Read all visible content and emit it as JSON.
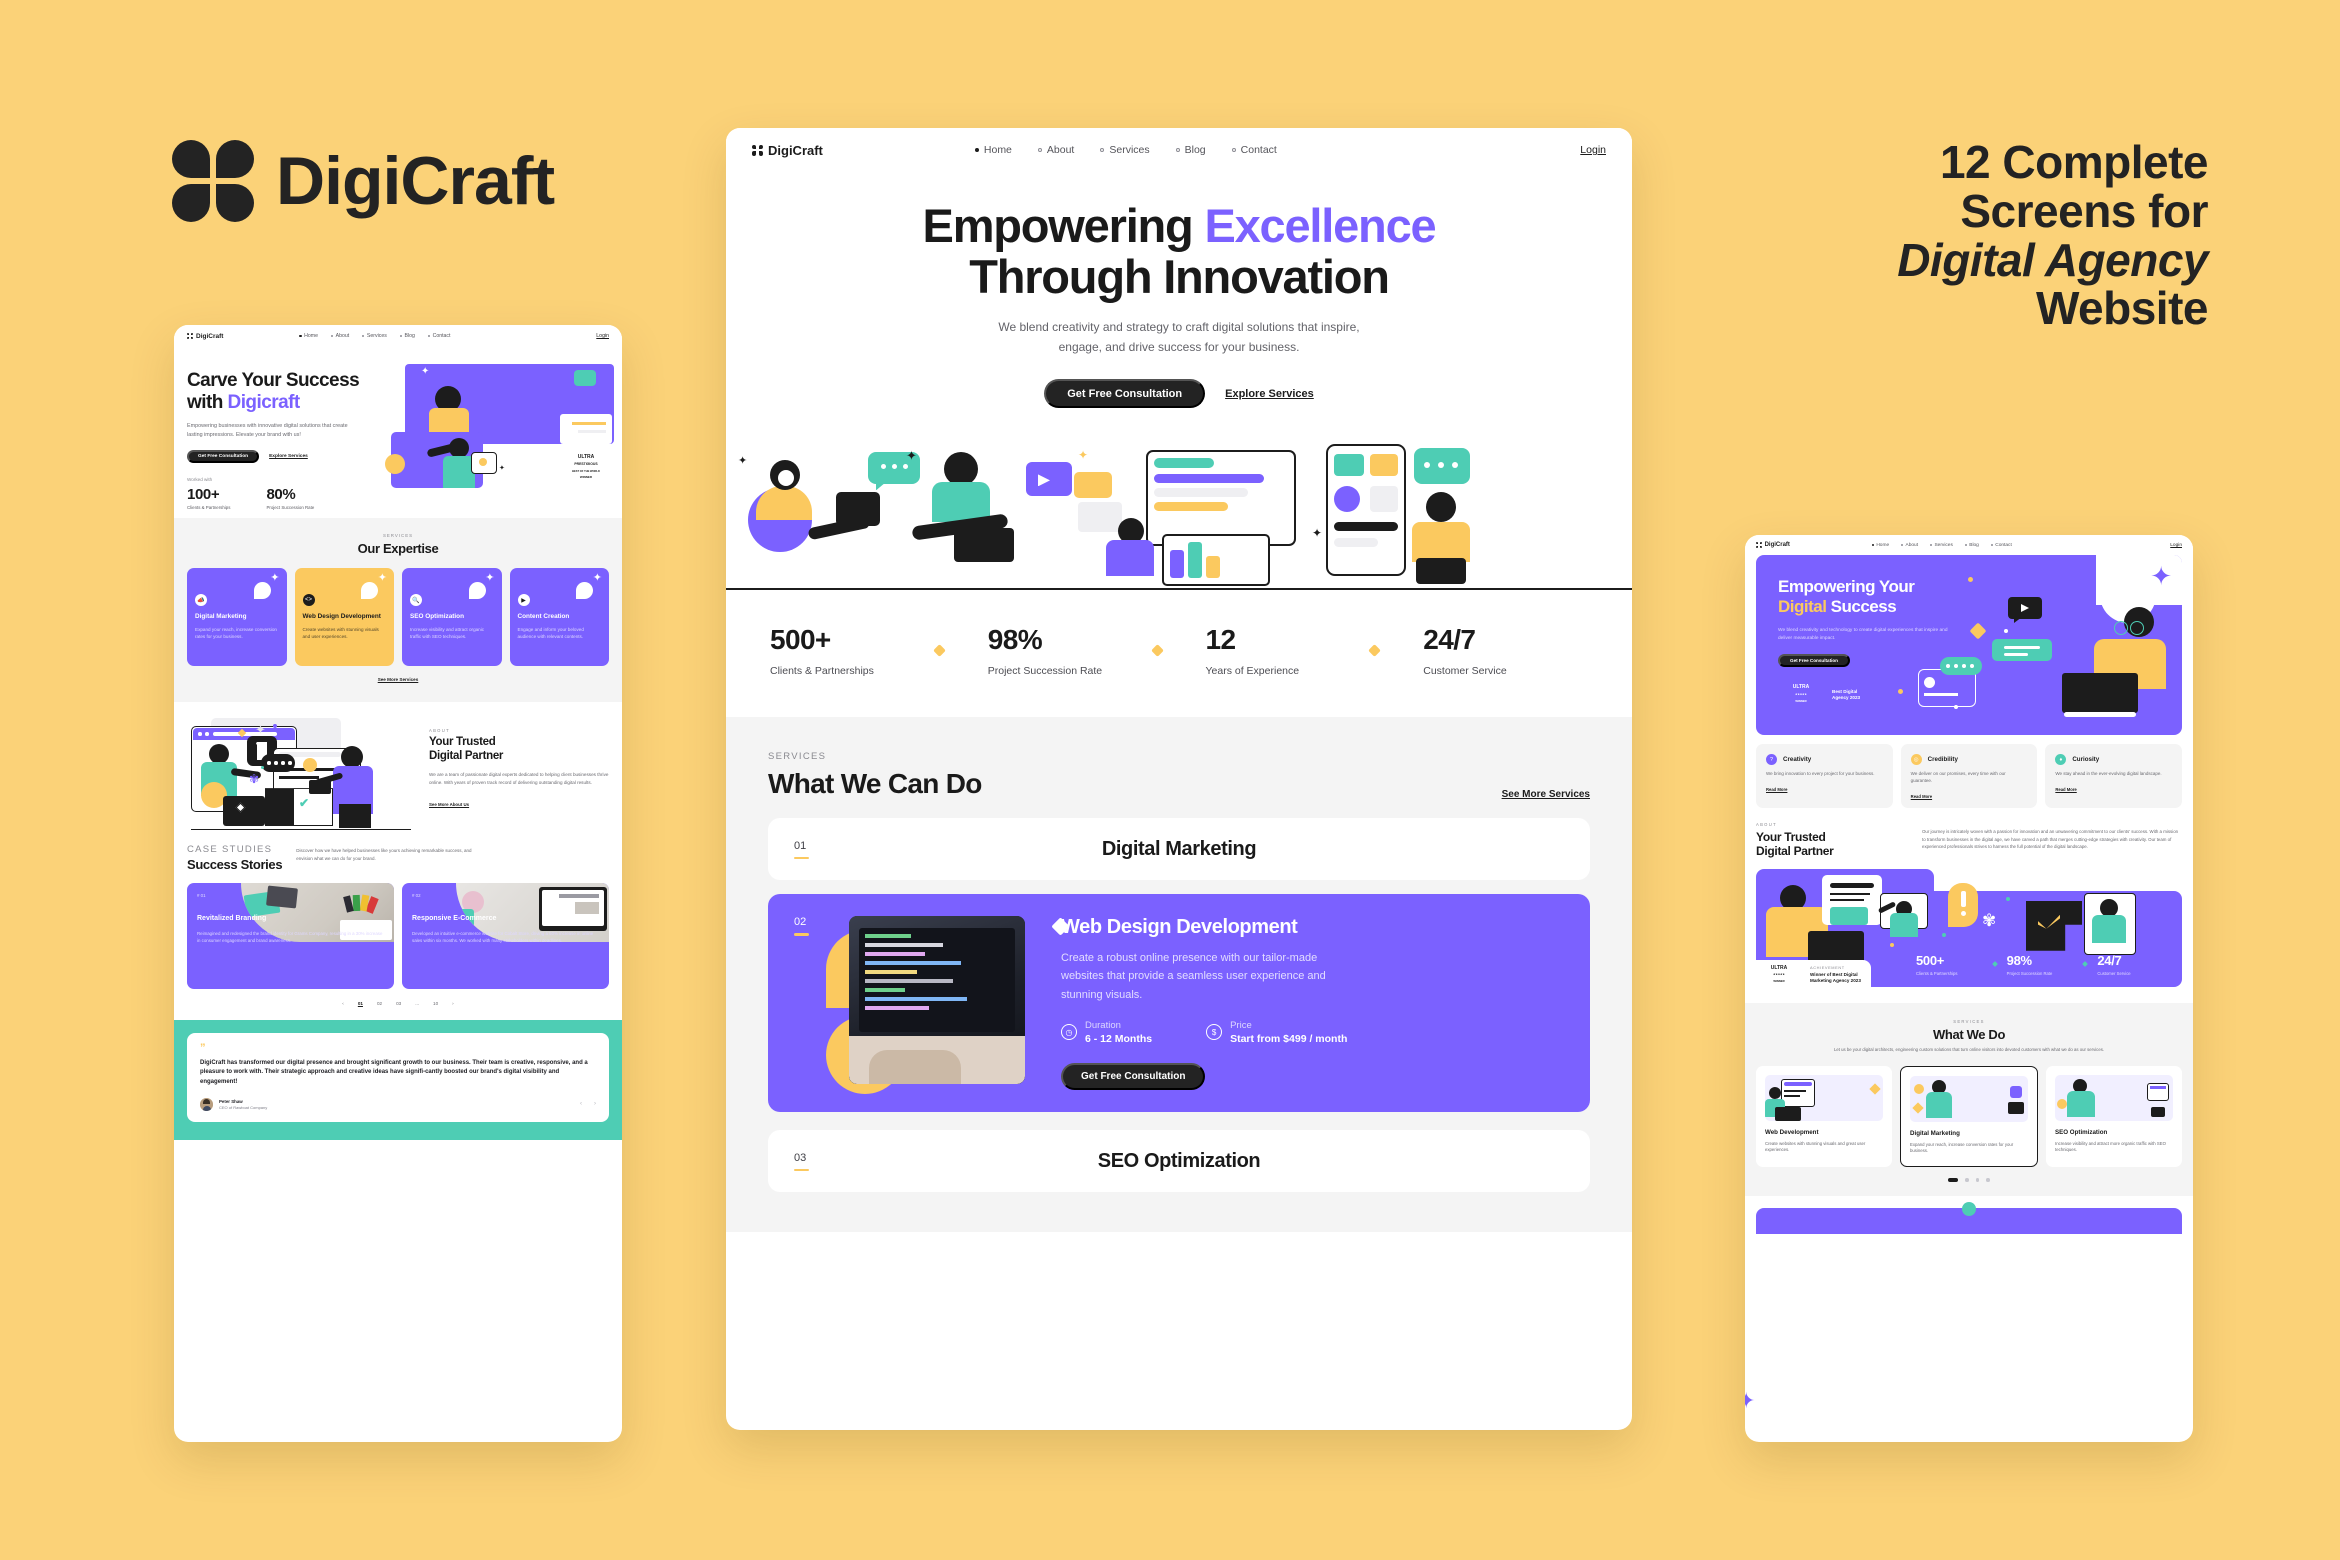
{
  "brand": {
    "name": "DigiCraft"
  },
  "promo": {
    "line1": "12 Complete",
    "line2": "Screens for",
    "line3": "Digital  Agency",
    "line4": "Website"
  },
  "nav": {
    "logo": "DigiCraft",
    "items": [
      {
        "label": "Home",
        "active": true
      },
      {
        "label": "About",
        "active": false
      },
      {
        "label": "Services",
        "active": false
      },
      {
        "label": "Blog",
        "active": false
      },
      {
        "label": "Contact",
        "active": false
      }
    ],
    "login": "Login"
  },
  "center": {
    "hero": {
      "title_plain": "Empowering ",
      "title_accent": "Excellence",
      "title_line2": "Through Innovation",
      "subtitle_line1": "We blend creativity and strategy to craft digital solutions that inspire,",
      "subtitle_line2": "engage, and drive success for your business.",
      "primary_cta": "Get Free Consultation",
      "secondary_cta": "Explore Services"
    },
    "stats": [
      {
        "value": "500+",
        "label": "Clients & Partnerships"
      },
      {
        "value": "98%",
        "label": "Project Succession Rate"
      },
      {
        "value": "12",
        "label": "Years of Experience"
      },
      {
        "value": "24/7",
        "label": "Customer Service"
      }
    ],
    "services": {
      "eyebrow": "SERVICES",
      "title": "What We Can Do",
      "see_more": "See More Services",
      "rows": [
        {
          "num": "01",
          "title": "Digital Marketing"
        },
        {
          "num": "03",
          "title": "SEO Optimization"
        }
      ],
      "expanded": {
        "num": "02",
        "title": "Web Design Development",
        "desc": "Create a robust online presence with our tailor-made websites that provide a seamless user experience and stunning visuals.",
        "duration_label": "Duration",
        "duration_value": "6 - 12 Months",
        "price_label": "Price",
        "price_value": "Start from $499 / month",
        "cta": "Get Free Consultation"
      }
    }
  },
  "left": {
    "hero": {
      "title_line1": "Carve Your Success",
      "title_line2_plain": "with ",
      "title_line2_accent": "Digicraft",
      "subtitle": "Empowering businesses with innovative digital solutions that create lasting impressions. Elevate your brand with us!",
      "primary_cta": "Get Free Consultation",
      "secondary_cta": "Explore Services",
      "worked_with": "Worked with",
      "stats": [
        {
          "value": "100+",
          "label": "Clients & Partnerships"
        },
        {
          "value": "80%",
          "label": "Project Succession Rate"
        }
      ],
      "award_line1": "ULTRA",
      "award_line2": "PRESTIGIOUS",
      "award_line3": "BEST OF THE WORLD",
      "award_line4": "WINNER"
    },
    "expertise": {
      "eyebrow": "SERVICES",
      "title": "Our Expertise",
      "see_more": "See More Services",
      "cards": [
        {
          "icon": "megaphone-icon",
          "title": "Digital Marketing",
          "desc": "Expand your reach, increase conversion rates for your business.",
          "theme": "p"
        },
        {
          "icon": "code-icon",
          "title": "Web Design Development",
          "desc": "Create websites with stunning visuals and user experiences.",
          "theme": "y"
        },
        {
          "icon": "search-icon",
          "title": "SEO Optimization",
          "desc": "Increase visibility and attract organic traffic with SEO techniques.",
          "theme": "p"
        },
        {
          "icon": "video-icon",
          "title": "Content Creation",
          "desc": "Engage and inform your beloved audience with relevant contents.",
          "theme": "p"
        }
      ]
    },
    "about": {
      "eyebrow": "ABOUT",
      "title_line1": "Your Trusted",
      "title_line2": "Digital Partner",
      "desc": "We are a team of passionate digital experts dedicated to helping client businesses thrive online. With years of proven track record of delivering outstanding digital results.",
      "link": "See More About Us"
    },
    "cases": {
      "eyebrow": "CASE STUDIES",
      "title": "Success Stories",
      "desc": "Discover how we have helped businesses like yours achieving remarkable success, and envision what we can do for your brand.",
      "cards": [
        {
          "idx": "# 01",
          "title": "Revitalized Branding",
          "desc": "Reimagined and redesigned the brand identity for Grams Company, resulting in a 30% increase in consumer engagement and brand awareness."
        },
        {
          "idx": "# 02",
          "title": "Responsive E-Commerce",
          "desc": "Developed an intuitive e-commerce website for Cobalt Store, driving a 50% increase in online sales within six months. We worked with many stakeholders within deadlines."
        }
      ],
      "pager": [
        "01",
        "02",
        "03",
        "...",
        "10"
      ],
      "pager_current": "01",
      "prev": "‹",
      "next": "›"
    },
    "testimonial": {
      "quote_mark": "”",
      "text": "DigiCraft has transformed our digital presence and brought significant growth to our business. Their team is creative, responsive, and a pleasure to work with. Their strategic approach and creative ideas have signifi-cantly boosted our brand's digital visibility and engagement!",
      "author": "Peter Shaw",
      "role": "CEO of Rawboat Company",
      "prev": "‹",
      "next": "›"
    }
  },
  "right": {
    "hero": {
      "title_line1": "Empowering Your",
      "title_line2_accent": "Digital",
      "title_line2_plain": " Success",
      "subtitle": "We blend creativity and technology to create digital experiences that inspire and deliver measurable impact.",
      "cta": "Get Free Consultation",
      "award_name": "ULTRA",
      "award_sub": "WINNER",
      "award_text_line1": "Best Digital",
      "award_text_line2": "Agency 2023"
    },
    "triple": [
      {
        "icon": "question-icon",
        "title": "Creativity",
        "desc": "We bring innovation to every project for your business.",
        "link": "Read More",
        "color": "#7B61FF"
      },
      {
        "icon": "shield-icon",
        "title": "Credibility",
        "desc": "We deliver on our promises, every time with our guarantee.",
        "link": "Read More",
        "color": "#FBC95F"
      },
      {
        "icon": "bulb-icon",
        "title": "Curiosity",
        "desc": "We stay ahead in the ever-evolving digital landscape.",
        "link": "Read More",
        "color": "#4ECDB4"
      }
    ],
    "about": {
      "eyebrow": "ABOUT",
      "title_line1": "Your Trusted",
      "title_line2": "Digital Partner",
      "desc": "Our journey is intricately woven with a passion for innovation and an unwavering commitment to our clients' success. With a mission to transform businesses in the digital age, we have carved a path that merges cutting-edge strategies with creativity. Our team of experienced professionals strives to harness the full potential of the digital landscape.",
      "achievement_label": "ACHIEVEMENT",
      "achievement_line1": "Winner of Best Digital",
      "achievement_line2": "Marketing Agency 2023",
      "stats": [
        {
          "value": "500+",
          "label": "Clients & Partnerships"
        },
        {
          "value": "98%",
          "label": "Project Succession Rate"
        },
        {
          "value": "24/7",
          "label": "Customer Service"
        }
      ]
    },
    "services": {
      "eyebrow": "SERVICES",
      "title": "What We Do",
      "lead": "Let us be your digital architects, engineering custom solutions that turn online visitors into devoted customers with what we do as our services.",
      "cards": [
        {
          "title": "Web Development",
          "desc": "Create websites with stunning visuals and great user experiences."
        },
        {
          "title": "Digital Marketing",
          "desc": "Expand your reach, increase conversion rates for your business."
        },
        {
          "title": "SEO Optimization",
          "desc": "Increase visibility and attract more organic traffic with SEO techniques."
        }
      ],
      "active_index": 1
    }
  }
}
